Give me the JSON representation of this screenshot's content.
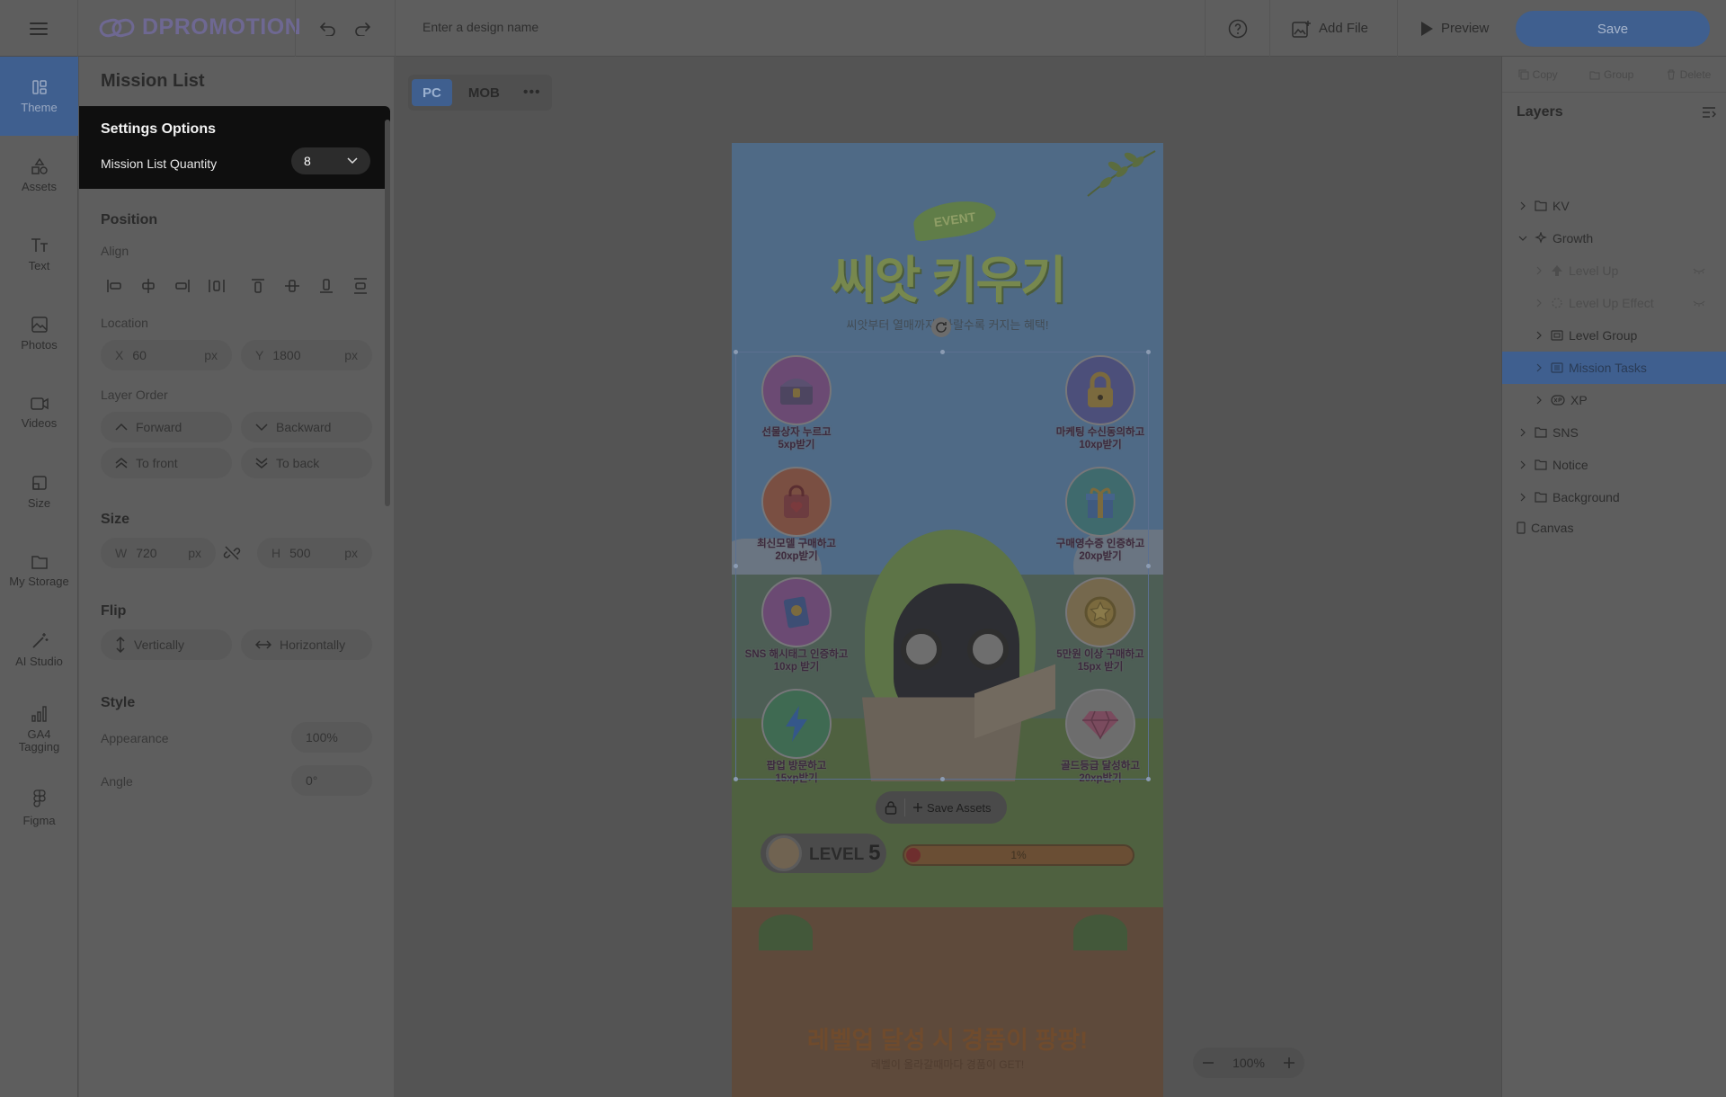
{
  "topbar": {
    "logo_text": "DPROMOTION",
    "design_name_placeholder": "Enter a design name",
    "add_file_label": "Add File",
    "preview_label": "Preview",
    "save_label": "Save"
  },
  "sidebar": {
    "items": [
      {
        "label": "Theme",
        "icon": "theme-icon"
      },
      {
        "label": "Assets",
        "icon": "assets-icon"
      },
      {
        "label": "Text",
        "icon": "text-icon"
      },
      {
        "label": "Photos",
        "icon": "photos-icon"
      },
      {
        "label": "Videos",
        "icon": "videos-icon"
      },
      {
        "label": "Size",
        "icon": "size-icon"
      },
      {
        "label": "My Storage",
        "icon": "folder-icon"
      },
      {
        "label": "AI Studio",
        "icon": "magic-wand-icon"
      },
      {
        "label": "GA4 Tagging",
        "icon": "analytics-icon"
      },
      {
        "label": "Figma",
        "icon": "figma-icon"
      }
    ]
  },
  "panel": {
    "title": "Mission List",
    "settings": {
      "heading": "Settings Options",
      "quantity_label": "Mission List Quantity",
      "quantity_value": "8"
    },
    "position": {
      "heading": "Position",
      "align_label": "Align",
      "location_label": "Location",
      "x_label": "X",
      "x_value": "60",
      "y_label": "Y",
      "y_value": "1800",
      "unit": "px",
      "layer_order_label": "Layer Order",
      "forward": "Forward",
      "backward": "Backward",
      "to_front": "To front",
      "to_back": "To back"
    },
    "size": {
      "heading": "Size",
      "w_label": "W",
      "w_value": "720",
      "h_label": "H",
      "h_value": "500",
      "unit": "px"
    },
    "flip": {
      "heading": "Flip",
      "vertically": "Vertically",
      "horizontally": "Horizontally"
    },
    "style": {
      "heading": "Style",
      "appearance_label": "Appearance",
      "appearance_value": "100%",
      "angle_label": "Angle",
      "angle_value": "0°"
    }
  },
  "canvas": {
    "tabs": [
      "PC",
      "MOB"
    ],
    "active_tab": "PC",
    "design": {
      "event_badge": "EVENT",
      "title": "씨앗 키우기",
      "subtitle": "씨앗부터 열매까지! 자랄수록 커지는 혜택!",
      "missions": [
        {
          "label": "선물상자 누르고\n5xp받기",
          "color": "#6b4a73",
          "icon": "treasure-chest-icon"
        },
        {
          "label": "마케팅 수신동의하고\n10xp받기",
          "color": "#4c4f7a",
          "icon": "lock-icon"
        },
        {
          "label": "최신모델 구매하고\n20xp받기",
          "color": "#7a4f42",
          "icon": "shopping-bag-icon"
        },
        {
          "label": "구매영수증 인증하고\n20xp받기",
          "color": "#3f6a6d",
          "icon": "gift-icon"
        },
        {
          "label": "SNS 해시태그 인증하고\n10xp 받기",
          "color": "#6b4a73",
          "icon": "book-icon"
        },
        {
          "label": "5만원 이상 구매하고\n15px 받기",
          "color": "#75684d",
          "icon": "star-coin-icon"
        },
        {
          "label": "팝업 방문하고\n15xp받기",
          "color": "#3f6a52",
          "icon": "lightning-icon"
        },
        {
          "label": "골드등급 달성하고\n20xp받기",
          "color": "#6d6d6d",
          "icon": "gem-icon"
        }
      ],
      "save_assets_label": "Save Assets",
      "level_label": "LEVEL",
      "level_value": "5",
      "progress_label": "1%",
      "progress_fraction": 0.01,
      "promo_highlight": "레벨업",
      "promo_text": " 달성 시 경품이 팡팡!",
      "promo_sub": "레벨이 올라갈때마다 경품이 GET!"
    },
    "zoom_label": "100%"
  },
  "layers": {
    "actions": {
      "copy": "Copy",
      "group": "Group",
      "delete": "Delete"
    },
    "heading": "Layers",
    "items": [
      {
        "label": "KV",
        "depth": 0,
        "kind": "folder",
        "expanded": false
      },
      {
        "label": "Growth",
        "depth": 0,
        "kind": "sparkle",
        "expanded": true
      },
      {
        "label": "Level Up",
        "depth": 1,
        "kind": "up",
        "dim": true,
        "hidden": true
      },
      {
        "label": "Level Up Effect",
        "depth": 1,
        "kind": "effect",
        "dim": true,
        "hidden": true
      },
      {
        "label": "Level Group",
        "depth": 1,
        "kind": "group"
      },
      {
        "label": "Mission Tasks",
        "depth": 1,
        "kind": "list",
        "selected": true
      },
      {
        "label": "XP",
        "depth": 1,
        "kind": "xp"
      },
      {
        "label": "SNS",
        "depth": 0,
        "kind": "folder"
      },
      {
        "label": "Notice",
        "depth": 0,
        "kind": "folder"
      },
      {
        "label": "Background",
        "depth": 0,
        "kind": "folder"
      },
      {
        "label": "Canvas",
        "depth": 0,
        "kind": "canvas",
        "nochev": true
      }
    ]
  }
}
